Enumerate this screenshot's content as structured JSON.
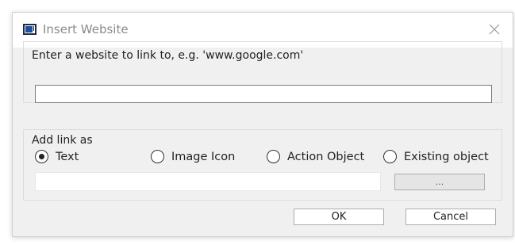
{
  "window": {
    "title": "Insert Website",
    "icon": "window-icon",
    "close_icon": "close-icon"
  },
  "url_section": {
    "label": "Enter a website to link to, e.g. 'www.google.com'",
    "value": "",
    "placeholder": ""
  },
  "link_section": {
    "label": "Add link as",
    "options": [
      {
        "label": "Text",
        "checked": true
      },
      {
        "label": "Image Icon",
        "checked": false
      },
      {
        "label": "Action Object",
        "checked": false
      },
      {
        "label": "Existing object",
        "checked": false
      }
    ],
    "text_value": "",
    "browse_label": "..."
  },
  "buttons": {
    "ok": "OK",
    "cancel": "Cancel"
  }
}
